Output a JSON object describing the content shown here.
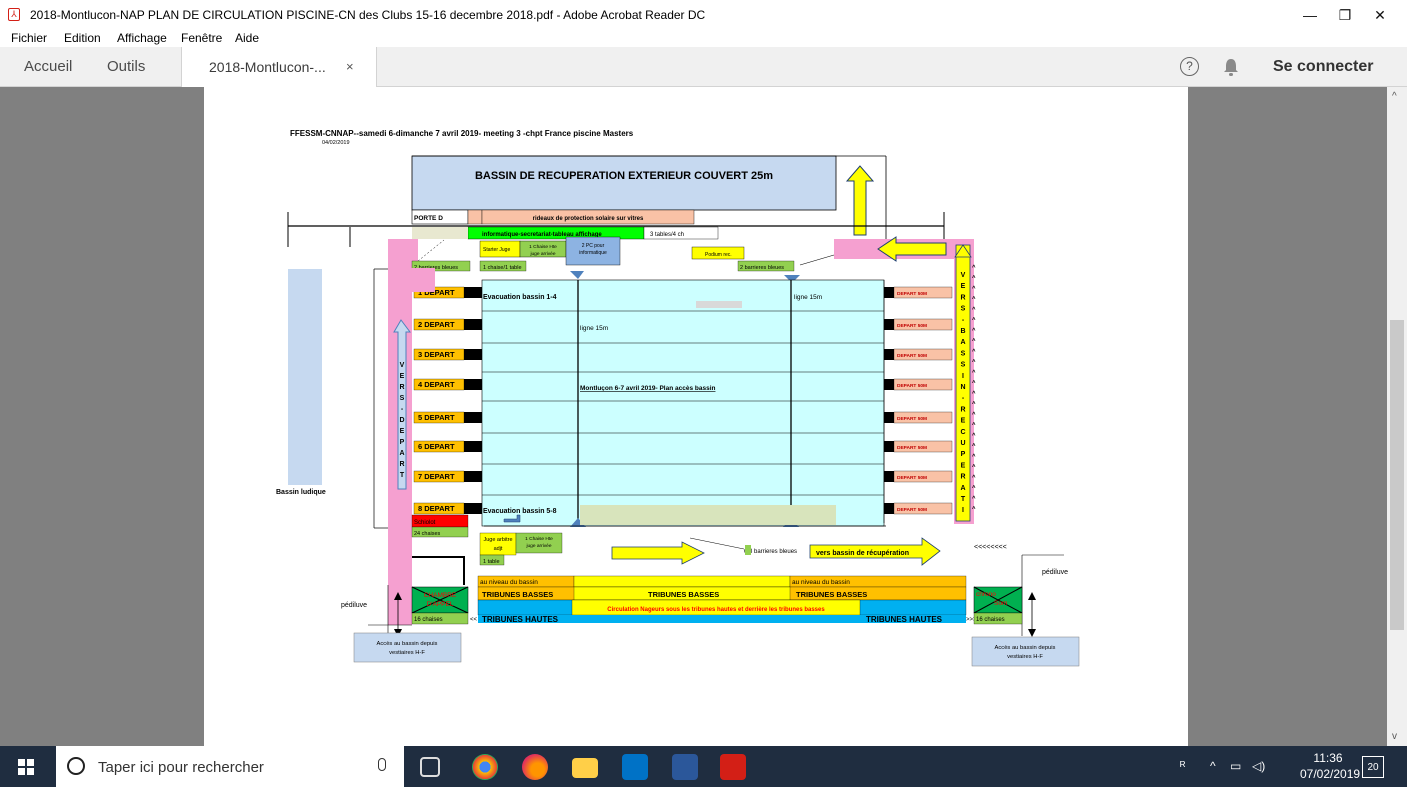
{
  "window": {
    "title": "2018-Montlucon-NAP PLAN DE CIRCULATION PISCINE-CN des Clubs 15-16 decembre 2018.pdf - Adobe Acrobat Reader DC",
    "minimize": "—",
    "restore": "❐",
    "close": "✕"
  },
  "menu": [
    "Fichier",
    "Edition",
    "Affichage",
    "Fenêtre",
    "Aide"
  ],
  "tabs": {
    "home": "Accueil",
    "tools": "Outils",
    "document": "2018-Montlucon-...",
    "close": "×",
    "help": "?",
    "signin": "Se connecter"
  },
  "scroll": {
    "up": "^",
    "down": "v"
  },
  "doc": {
    "heading": "FFESSM-CNNAP--samedi 6-dimanche 7 avril 2019- meeting 3 -chpt France piscine Masters",
    "date": "04/02/2019",
    "bassin_recup": "BASSIN DE RECUPERATION EXTERIEUR COUVERT 25m",
    "porte": "PORTE D",
    "rideaux": "rideaux de protection solaire sur vitres",
    "info": "informatique-secretariat-tableau affichage",
    "tables": "3 tables/4 ch",
    "starter": "Starter Juge",
    "chaise_hte_1": "1 Chaise Hte",
    "juge_arrivee_1": "juge arrivée",
    "pc": "2 PC pour",
    "pc2": "informatique",
    "podium": "Podium rec.",
    "barrieres_1": "2 barrieres bleues",
    "chaise_table": "1 chaise/1 table",
    "barrieres_2": "2 barrieres bleues",
    "departs": [
      "1  DEPART",
      "2  DEPART",
      "3  DEPART",
      "4  DEPART",
      "5  DEPART",
      "6  DEPART",
      "7  DEPART",
      "8  DEPART"
    ],
    "depart50": "DEPART 50M",
    "evac_14": "Evacuation bassin 1-4",
    "evac_58": "Evacuation bassin 5-8",
    "ligne15_a": "ligne 15m",
    "ligne15_b": "ligne 15m",
    "plan": "Montluçon 6-7 avril 2019- Plan accès bassin",
    "vers_depart": [
      "V",
      "E",
      "R",
      "S",
      "-",
      "D",
      "E",
      "P",
      "A",
      "R",
      "T"
    ],
    "vers_bassin": [
      "V",
      "E",
      "R",
      "S",
      "-",
      "B",
      "A",
      "S",
      "S",
      "I",
      "N",
      "-",
      "R",
      "E",
      "C",
      "U",
      "P",
      "E",
      "R",
      "A",
      "T",
      "I"
    ],
    "bassin_ludique": "Bassin ludique",
    "schiolot": "Schiolot",
    "chaises_24": "24 chaises",
    "juge_arbitre": "Juge arbitre",
    "adjt": "adjt",
    "table_1": "1 table",
    "chaise_hte_2": "1 Chaise Hte",
    "juge_arrivee_2": "juge arrivée",
    "barrieres_68": "6/8 barrieres bleues",
    "vers_recup": "vers bassin de récupération",
    "chevrons": "<<<<<<<<",
    "pediluve_r": "pédiluve",
    "pediluve_l": "pédiluve",
    "niveau_1": "au niveau du bassin",
    "niveau_2": "au niveau du bassin",
    "tribunes_basses": "TRIBUNES BASSES",
    "chambre": "CHAMBRE",
    "appel": "D'APPEL",
    "chrono": "chrono",
    "som": "Som",
    "circulation": "Circulation Nageurs sous les tribunes hautes et derrière les tribunes basses",
    "chaises_16": "16 chaises",
    "tribunes_hautes": "TRIBUNES HAUTES",
    "lt": "<<",
    "gt": ">>>",
    "acces_1": "Accès au bassin depuis",
    "acces_2": "vestiaires H-F"
  },
  "taskbar": {
    "search_placeholder": "Taper ici pour rechercher",
    "time": "11:36",
    "date": "07/02/2019",
    "notif": "20"
  }
}
